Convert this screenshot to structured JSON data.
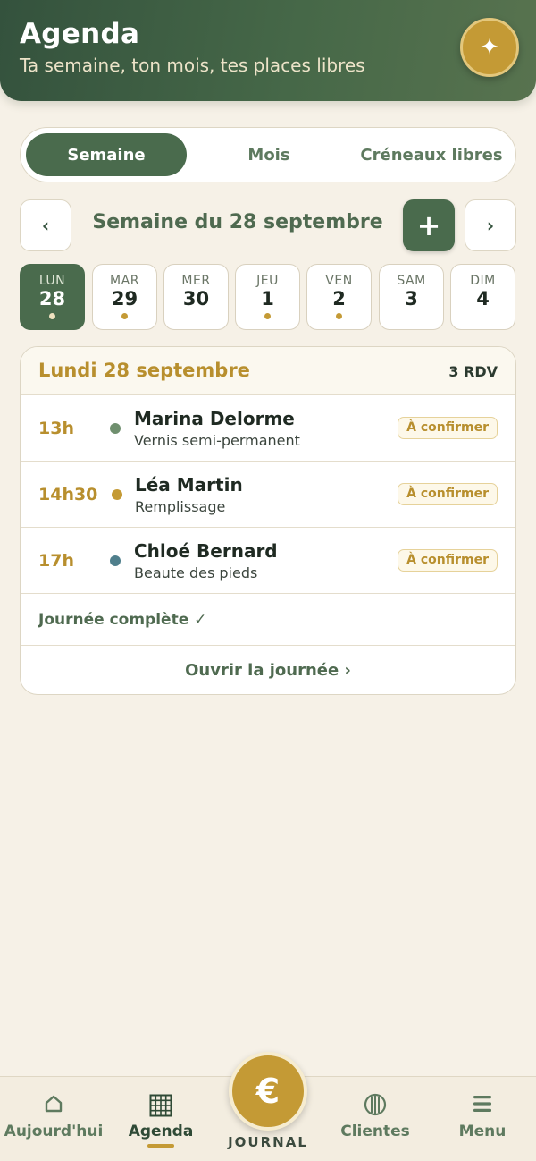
{
  "header": {
    "title": "Agenda",
    "subtitle": "Ta semaine, ton mois, tes places libres",
    "action_icon": "sparkle-icon"
  },
  "segment": {
    "tabs": [
      {
        "label": "Semaine",
        "active": true
      },
      {
        "label": "Mois",
        "active": false
      },
      {
        "label": "Créneaux libres",
        "active": false
      }
    ]
  },
  "week_nav": {
    "prev": "‹",
    "title": "Semaine du 28 septembre",
    "add": "+",
    "next": "›"
  },
  "days": [
    {
      "name": "LUN",
      "num": "28",
      "dot": true,
      "active": true
    },
    {
      "name": "MAR",
      "num": "29",
      "dot": true,
      "active": false
    },
    {
      "name": "MER",
      "num": "30",
      "dot": false,
      "active": false
    },
    {
      "name": "JEU",
      "num": "1",
      "dot": true,
      "active": false
    },
    {
      "name": "VEN",
      "num": "2",
      "dot": true,
      "active": false
    },
    {
      "name": "SAM",
      "num": "3",
      "dot": false,
      "active": false
    },
    {
      "name": "DIM",
      "num": "4",
      "dot": false,
      "active": false
    }
  ],
  "day_card": {
    "title": "Lundi 28 septembre",
    "count": "3 RDV",
    "appointments": [
      {
        "time": "13h",
        "name": "Marina Delorme",
        "service": "Vernis semi-permanent",
        "status": "À confirmer",
        "dot_color": "#6f8f6e"
      },
      {
        "time": "14h30",
        "name": "Léa Martin",
        "service": "Remplissage",
        "status": "À confirmer",
        "dot_color": "#c49a35"
      },
      {
        "time": "17h",
        "name": "Chloé Bernard",
        "service": "Beaute des pieds",
        "status": "À confirmer",
        "dot_color": "#4f7f8c"
      }
    ],
    "full_label": "Journée complète ✓",
    "open_label": "Ouvrir la journée ›"
  },
  "bottom_nav": {
    "tabs": [
      {
        "label": "Aujourd'hui",
        "icon": "home-icon"
      },
      {
        "label": "Agenda",
        "icon": "calendar-grid-icon",
        "active": true
      },
      {
        "label": "Clientes",
        "icon": "clients-icon"
      },
      {
        "label": "Menu",
        "icon": "menu-icon"
      }
    ],
    "center": {
      "symbol": "€",
      "label": "JOURNAL"
    }
  },
  "colors": {
    "primary": "#4a6b4d",
    "accent": "#c49a35",
    "background": "#f6f1e7"
  }
}
